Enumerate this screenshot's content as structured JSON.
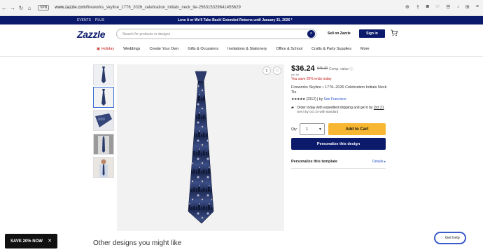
{
  "browser": {
    "vpn_label": "VPN",
    "url_host": "www.zazzle.com",
    "url_path": "/fireworks_skyline_1776_2026_celebration_initials_neck_tie-256315329641455629"
  },
  "promo": {
    "events": "EVENTS",
    "plus": "PLUS",
    "message": "Love it or We'll Take Back!   Extended Returns until January 31, 2026 *"
  },
  "header": {
    "logo": "Zazzle",
    "search_placeholder": "Search for products or designs",
    "sell_label": "Sell on Zazzle",
    "signin_label": "Sign in"
  },
  "categories": [
    "Holiday",
    "Weddings",
    "Create Your Own",
    "Gifts & Occasions",
    "Invitations & Stationery",
    "Office & School",
    "Crafts & Party Supplies",
    "More"
  ],
  "product": {
    "price": "$36.24",
    "old_price": "$45.30",
    "comp_value": "Comp. value ⓘ",
    "per_unit": "per tie",
    "savings": "You save 20% ends today",
    "title": "Fireworks Skyline • 1776–2026 Celebration Initials Neck Tie",
    "stars": "★★★★★",
    "reviews": "(2312)",
    "by_label": " | by ",
    "seller": "San Francisco",
    "ship_line1_a": "Order today with expedited shipping and get it by ",
    "ship_date": "Oct 21",
    "ship_line2": "Get it by Oct 24 with standard",
    "qty_label": "Qty:",
    "qty_value": "1",
    "add_to_cart": "Add to Cart",
    "personalize_btn": "Personalize this design",
    "personalize_template": "Personalize this template",
    "details": "Details ▸"
  },
  "other_designs": "Other designs you might like",
  "save_banner": "SAVE 20% NOW",
  "get_help": "Get help",
  "colors": {
    "brand_navy": "#0b1a6b",
    "cart_yellow": "#f7b733",
    "sale_red": "#c41e1e",
    "link_blue": "#2a55c8"
  }
}
